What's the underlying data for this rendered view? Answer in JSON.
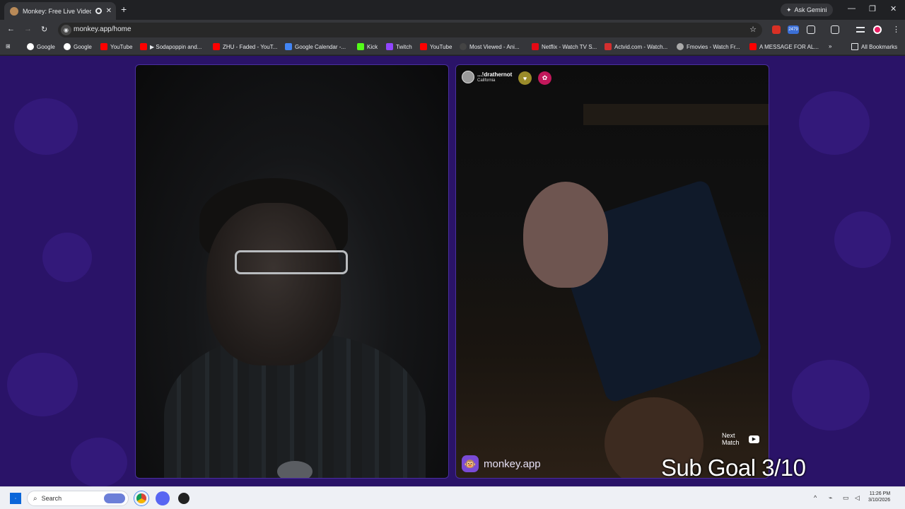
{
  "browser": {
    "tab_title": "Monkey: Free Live Video Ch",
    "new_tab_symbol": "+",
    "ask_gemini": "Ask Gemini",
    "url": "monkey.app/home",
    "window_controls": {
      "minimize": "—",
      "restore": "❐",
      "close": "✕"
    },
    "extension_badge": "2479"
  },
  "bookmarks": [
    {
      "label": "Google",
      "icon": "google-icon",
      "color": "#ffffff"
    },
    {
      "label": "Google",
      "icon": "google-icon",
      "color": "#ffffff"
    },
    {
      "label": "YouTube",
      "icon": "youtube-icon",
      "color": "#ff0000"
    },
    {
      "label": "▶ Sodapoppin and...",
      "icon": "youtube-icon",
      "color": "#ff0000"
    },
    {
      "label": "ZHU - Faded - YouT...",
      "icon": "youtube-icon",
      "color": "#ff0000"
    },
    {
      "label": "Google Calendar -...",
      "icon": "calendar-icon",
      "color": "#4285f4"
    },
    {
      "label": "Kick",
      "icon": "kick-icon",
      "color": "#53fc18"
    },
    {
      "label": "Twitch",
      "icon": "twitch-icon",
      "color": "#9146ff"
    },
    {
      "label": "YouTube",
      "icon": "youtube-icon",
      "color": "#ff0000"
    },
    {
      "label": "Most Viewed - Ani...",
      "icon": "anime-icon",
      "color": "#444444"
    },
    {
      "label": "Netflix - Watch TV S...",
      "icon": "netflix-icon",
      "color": "#e50914"
    },
    {
      "label": "Actvid.com - Watch...",
      "icon": "actvid-icon",
      "color": "#d32f2f"
    },
    {
      "label": "Fmovies - Watch Fr...",
      "icon": "fmovies-icon",
      "color": "#aaaaaa"
    },
    {
      "label": "A MESSAGE FOR AL...",
      "icon": "youtube-icon",
      "color": "#ff0000"
    }
  ],
  "bookmarks_overflow": "»",
  "all_bookmarks": "All Bookmarks",
  "remote_user": {
    "name": "...!drathernot",
    "location": "California"
  },
  "brand": {
    "name": "monkey.app",
    "logo": "🐵"
  },
  "next_match": {
    "line1": "Next",
    "line2": "Match"
  },
  "overlay": {
    "sub_goal": "Sub Goal 3/10"
  },
  "taskbar": {
    "search_placeholder": "Search",
    "time": "11:26 PM",
    "date": "3/10/2026"
  },
  "colors": {
    "page_background": "#2a1368",
    "browser_chrome": "#35363a",
    "brand_accent": "#7a4bd6"
  }
}
